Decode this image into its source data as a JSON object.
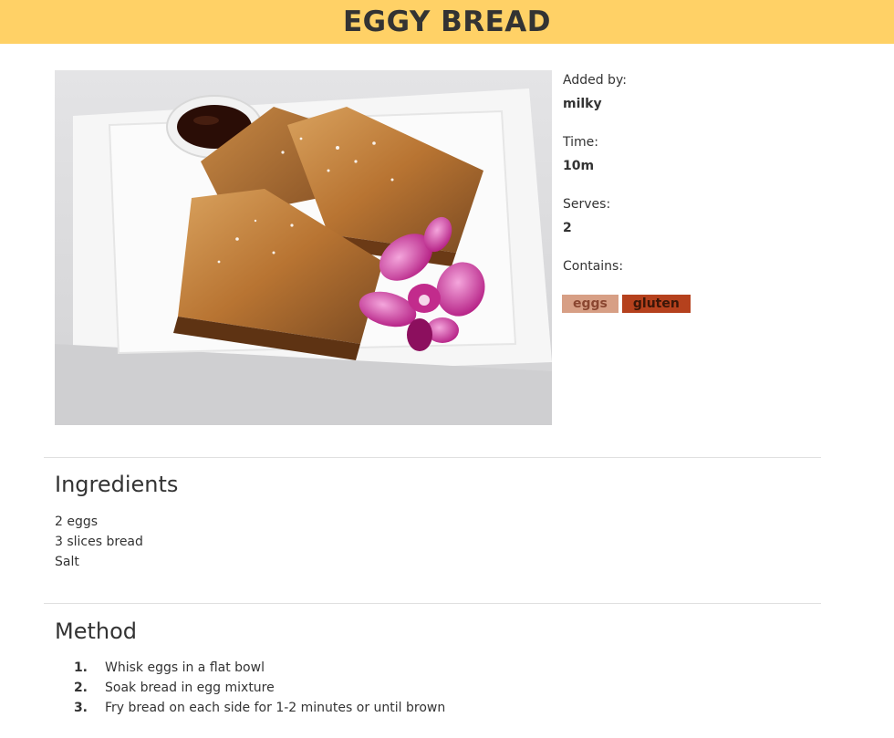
{
  "recipe": {
    "title": "EGGY BREAD",
    "image_alt": "Eggy bread on a white plate with syrup and an orchid"
  },
  "info": {
    "added_by_label": "Added by:",
    "added_by_value": "milky",
    "time_label": "Time:",
    "time_value": "10m",
    "serves_label": "Serves:",
    "serves_value": "2",
    "contains_label": "Contains:",
    "tags": [
      {
        "label": "eggs",
        "color": "#d79f85"
      },
      {
        "label": "gluten",
        "color": "#b5411d"
      }
    ]
  },
  "ingredients": {
    "heading": "Ingredients",
    "items": [
      "2 eggs",
      "3 slices bread",
      "Salt"
    ]
  },
  "method": {
    "heading": "Method",
    "steps": [
      {
        "num": "1.",
        "text": "Whisk eggs in a flat bowl"
      },
      {
        "num": "2.",
        "text": "Soak bread in egg mixture"
      },
      {
        "num": "3.",
        "text": "Fry bread on each side for 1-2 minutes or until brown"
      }
    ]
  },
  "colors": {
    "header_bg": "#ffd166",
    "text": "#333333"
  }
}
